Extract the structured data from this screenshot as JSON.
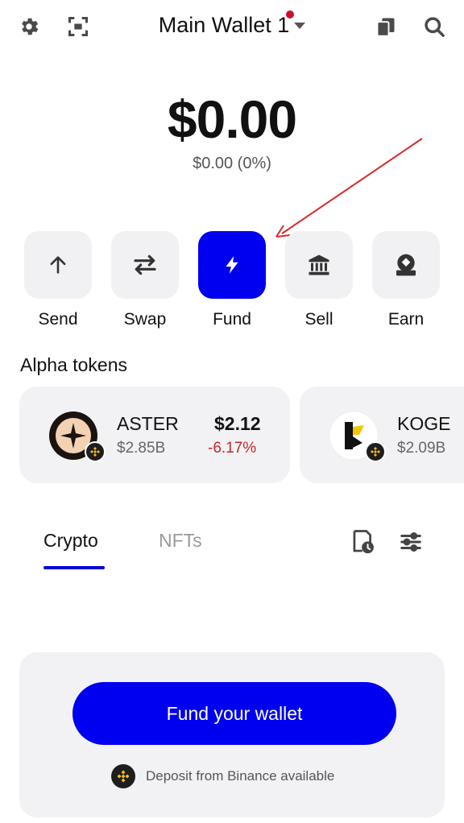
{
  "header": {
    "title": "Main Wallet 1",
    "icons": [
      "gear-icon",
      "scan-icon",
      "copy-icon",
      "search-icon"
    ]
  },
  "balance": {
    "amount": "$0.00",
    "change": "$0.00 (0%)"
  },
  "actions": [
    {
      "label": "Send",
      "icon": "arrow-up-icon"
    },
    {
      "label": "Swap",
      "icon": "swap-arrows-icon"
    },
    {
      "label": "Fund",
      "icon": "lightning-icon"
    },
    {
      "label": "Sell",
      "icon": "bank-icon"
    },
    {
      "label": "Earn",
      "icon": "earn-icon"
    }
  ],
  "alpha": {
    "title": "Alpha tokens",
    "tokens": [
      {
        "name": "ASTER",
        "market_cap": "$2.85B",
        "price": "$2.12",
        "change": "-6.17%"
      },
      {
        "name": "KOGE",
        "market_cap": "$2.09B"
      }
    ]
  },
  "tabs": [
    {
      "label": "Crypto",
      "active": true
    },
    {
      "label": "NFTs",
      "active": false
    }
  ],
  "fund": {
    "button_label": "Fund your wallet",
    "deposit_text": "Deposit from Binance available"
  },
  "colors": {
    "primary": "#0000f0",
    "negative": "#c62828",
    "card_bg": "#f2f2f4",
    "annotation_arrow": "#d42a2a"
  }
}
